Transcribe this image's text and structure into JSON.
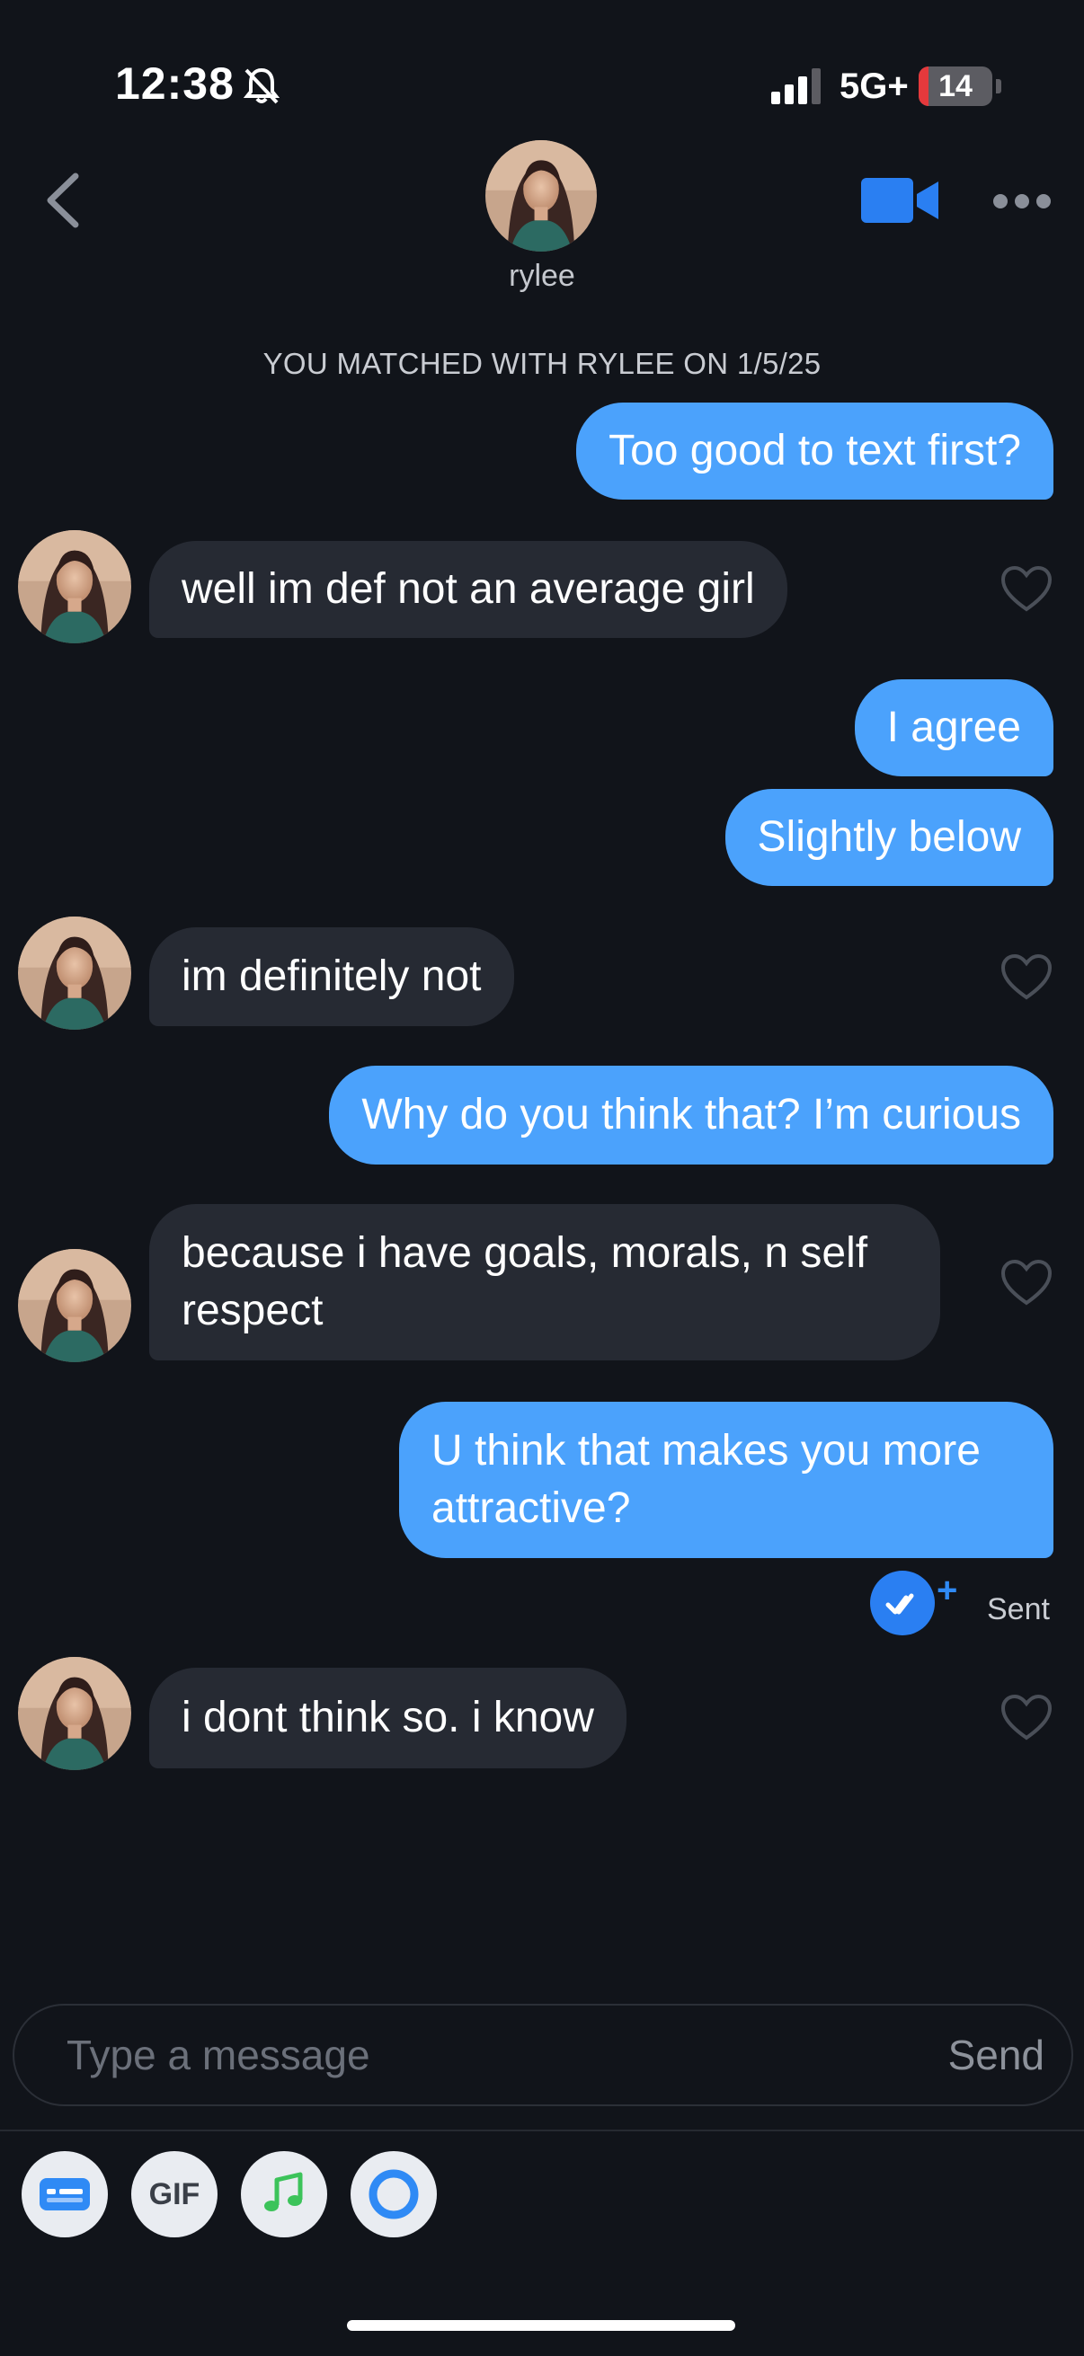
{
  "status_bar": {
    "time": "12:38",
    "network": "5G+",
    "battery": "14",
    "battery_level_percent": 14
  },
  "header": {
    "name": "rylee",
    "accent_color": "#2a7ff2"
  },
  "match_banner": "YOU MATCHED WITH RYLEE ON 1/5/25",
  "messages": [
    {
      "from": "me",
      "text": "Too good to text first?"
    },
    {
      "from": "them",
      "text": "well im def not an average girl"
    },
    {
      "from": "me",
      "text": "I agree"
    },
    {
      "from": "me",
      "text": "Slightly below"
    },
    {
      "from": "them",
      "text": "im definitely not"
    },
    {
      "from": "me",
      "text": "Why do you think that? I’m curious"
    },
    {
      "from": "them",
      "text": "because i have goals, morals, n self respect"
    },
    {
      "from": "me",
      "text": "U think that makes you more attractive?"
    },
    {
      "from": "them",
      "text": "i dont think so. i know"
    }
  ],
  "read_receipt": {
    "plus": "+",
    "status": "Sent"
  },
  "composer": {
    "placeholder": "Type a message",
    "send_label": "Send"
  },
  "toolbar": {
    "gif_label": "GIF",
    "icons": [
      "card-icon",
      "gif-icon",
      "music-icon",
      "circle-icon"
    ]
  },
  "colors": {
    "outgoing_bubble": "#4ba2fc",
    "incoming_bubble": "#262a33",
    "background": "#11141a"
  }
}
